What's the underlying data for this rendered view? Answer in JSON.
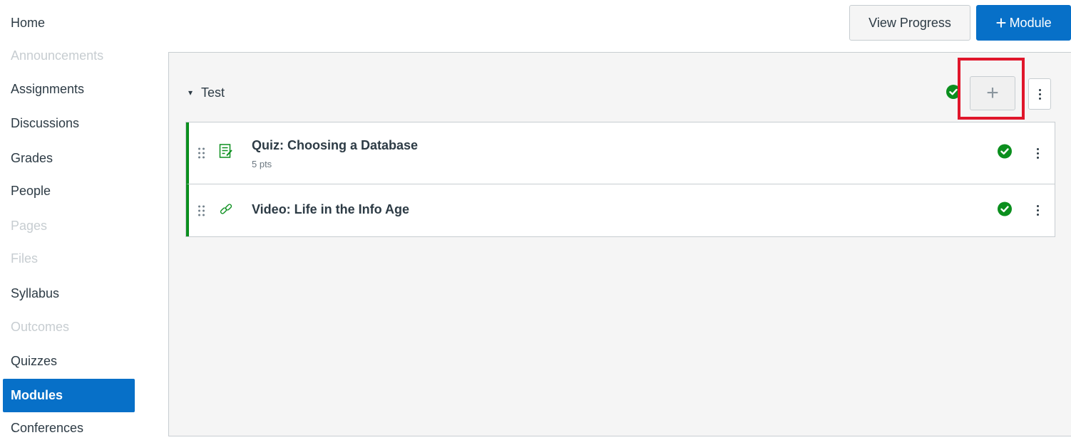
{
  "nav": {
    "items": [
      {
        "label": "Home",
        "state": "normal"
      },
      {
        "label": "Announcements",
        "state": "disabled"
      },
      {
        "label": "Assignments",
        "state": "normal"
      },
      {
        "label": "Discussions",
        "state": "normal"
      },
      {
        "label": "Grades",
        "state": "normal"
      },
      {
        "label": "People",
        "state": "normal"
      },
      {
        "label": "Pages",
        "state": "disabled"
      },
      {
        "label": "Files",
        "state": "disabled"
      },
      {
        "label": "Syllabus",
        "state": "normal"
      },
      {
        "label": "Outcomes",
        "state": "disabled"
      },
      {
        "label": "Quizzes",
        "state": "normal"
      },
      {
        "label": "Modules",
        "state": "active"
      },
      {
        "label": "Conferences",
        "state": "normal"
      }
    ]
  },
  "header": {
    "view_progress_label": "View Progress",
    "add_module_plus": "+",
    "add_module_label": "Module"
  },
  "module": {
    "title": "Test",
    "caret_glyph": "▾",
    "add_item_glyph": "+",
    "items": [
      {
        "title": "Quiz: Choosing a Database",
        "subtitle": "5 pts",
        "icon": "quiz-icon"
      },
      {
        "title": "Video: Life in the Info Age",
        "subtitle": "",
        "icon": "link-icon"
      }
    ]
  },
  "colors": {
    "accent": "#0770c8",
    "published_green": "#0b8f1e",
    "highlight_red": "#e0162b"
  }
}
